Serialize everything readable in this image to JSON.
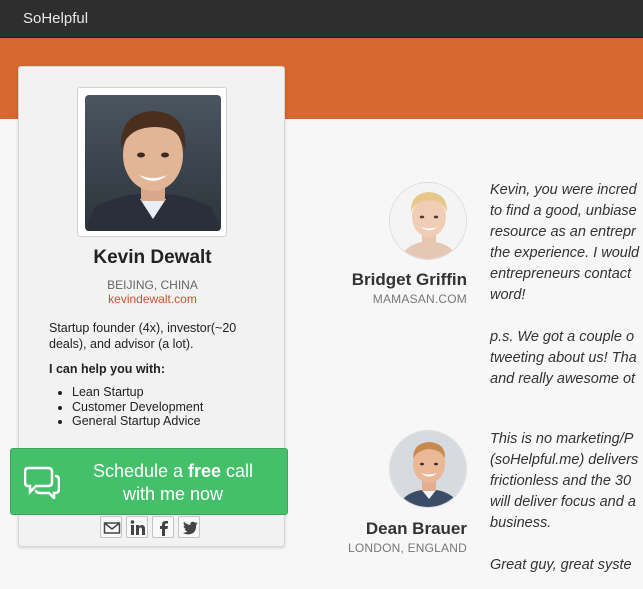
{
  "app": {
    "brand": "SoHelpful"
  },
  "profile": {
    "name": "Kevin Dewalt",
    "location": "BEIJING, CHINA",
    "website": "kevindewalt.com",
    "bio": "Startup founder (4x), investor(~20 deals), and advisor (a lot).",
    "help_title": "I can help you with:",
    "help_items": [
      "Lean Startup",
      "Customer Development",
      "General Startup Advice"
    ]
  },
  "cta": {
    "line1_pre": "Schedule a ",
    "line1_bold": "free",
    "line1_post": " call",
    "line2": "with me now"
  },
  "socials": [
    "email-icon",
    "linkedin-icon",
    "facebook-icon",
    "twitter-icon"
  ],
  "testimonials": [
    {
      "name": "Bridget Griffin",
      "org": "MAMASAN.COM",
      "lines": [
        "Kevin, you were incred",
        "to find a good, unbiase",
        "resource as an entrepr",
        "the experience. I would",
        "entrepreneurs contact",
        "word!",
        "",
        "p.s. We got a couple o",
        "tweeting about us! Tha",
        "and really awesome ot"
      ]
    },
    {
      "name": "Dean Brauer",
      "org": "LONDON, ENGLAND",
      "lines": [
        "This is no marketing/P",
        "(soHelpful.me) delivers",
        "frictionless and the 30",
        "will deliver focus and a",
        "business.",
        "",
        "Great guy, great syste"
      ]
    }
  ],
  "colors": {
    "topbar": "#2e2e2e",
    "banner": "#d76830",
    "cta": "#44c06a",
    "link": "#c9532a"
  }
}
